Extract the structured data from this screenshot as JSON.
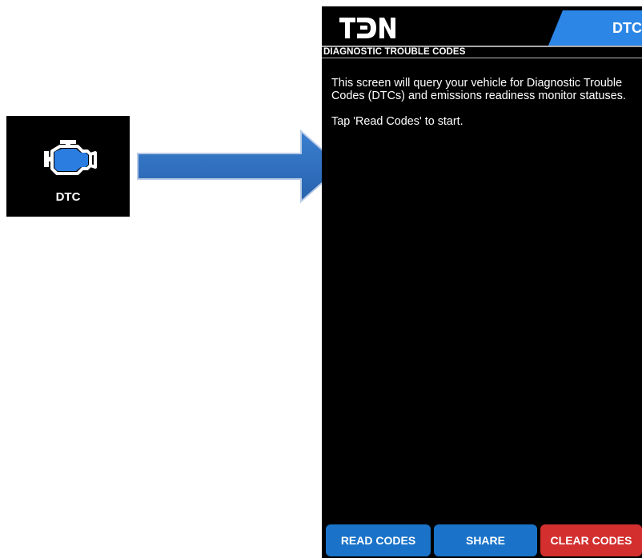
{
  "tile": {
    "label": "DTC",
    "icon": "engine-icon",
    "accent_color": "#2b7de0"
  },
  "arrow": {
    "icon": "arrow-right-icon",
    "color": "#2f6fc0"
  },
  "app": {
    "logo_text": "TDN",
    "tab_label": "DTC",
    "tab_color": "#2b86e6",
    "section_title": "DIAGNOSTIC TROUBLE CODES",
    "paragraphs": [
      "This screen will query your vehicle for Diagnostic Trouble Codes (DTCs) and emissions readiness monitor statuses.",
      "Tap 'Read Codes' to start."
    ],
    "buttons": {
      "read_codes": "READ CODES",
      "share": "SHARE",
      "clear_codes": "CLEAR CODES"
    },
    "button_colors": {
      "primary": "#1a73c9",
      "danger": "#d32f2f"
    }
  }
}
